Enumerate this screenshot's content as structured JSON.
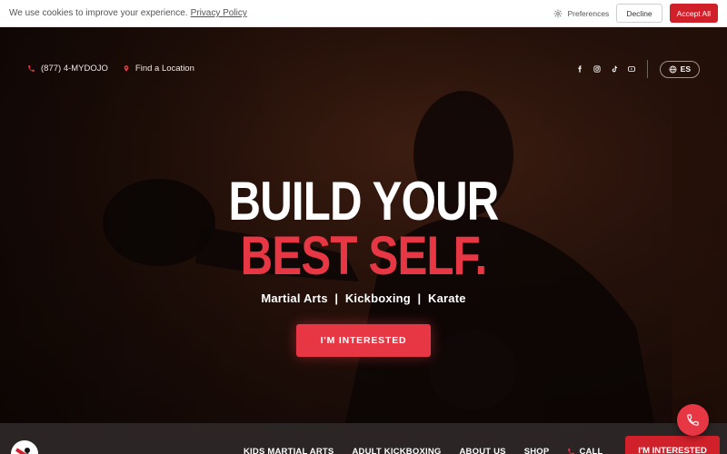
{
  "cookie_bar": {
    "message": "We use cookies to improve your experience.",
    "privacy_link": "Privacy Policy",
    "preferences_label": "Preferences",
    "decline_label": "Decline",
    "accept_label": "Accept All"
  },
  "topbar": {
    "phone": "(877) 4-MYDOJO",
    "location": "Find a Location",
    "social_icons": [
      "facebook-icon",
      "instagram-icon",
      "tiktok-icon",
      "youtube-icon"
    ],
    "language": "ES"
  },
  "hero": {
    "headline_line1": "BUILD YOUR",
    "headline_line2": "BEST SELF.",
    "tagline": "Martial Arts  |  Kickboxing  |  Karate",
    "cta_label": "I'M INTERESTED"
  },
  "nav": {
    "links": [
      "KIDS MARTIAL ARTS",
      "ADULT KICKBOXING",
      "ABOUT US",
      "SHOP"
    ],
    "call_label": "CALL",
    "cta_label": "I'M INTERESTED"
  },
  "colors": {
    "accent": "#e83744",
    "accent_dark": "#d0202a",
    "nav_bg": "#2b2625"
  }
}
